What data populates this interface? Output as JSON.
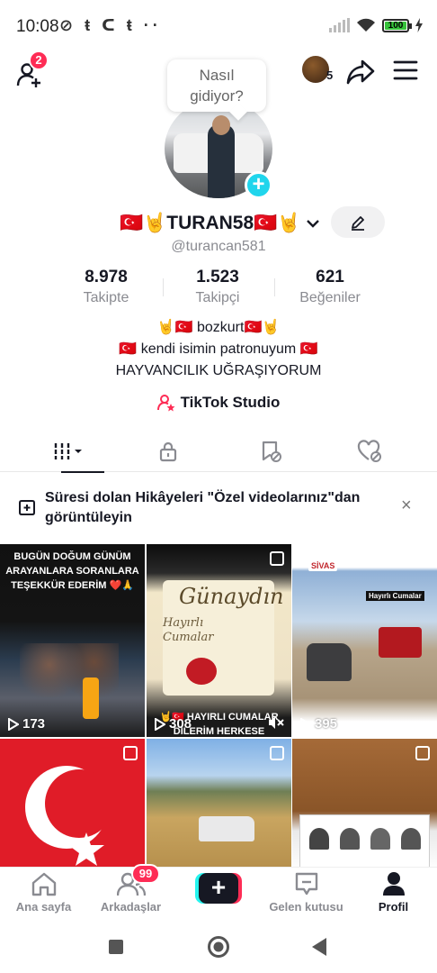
{
  "status_bar": {
    "time": "10:08",
    "notifications": "⊘ ŧ ᑕ ŧ ··",
    "battery": "100"
  },
  "top_bar": {
    "friend_requests_badge": "2",
    "story_count": "5"
  },
  "bubble": {
    "text_line1": "Nasıl",
    "text_line2": "gidiyor?"
  },
  "profile": {
    "display_name": "🇹🇷🤘TURAN58🇹🇷🤘",
    "handle": "@turancan581",
    "stats": [
      {
        "value": "8.978",
        "label": "Takipte"
      },
      {
        "value": "1.523",
        "label": "Takipçi"
      },
      {
        "value": "621",
        "label": "Beğeniler"
      }
    ],
    "bio": [
      "🤘🇹🇷 bozkurt🇹🇷🤘",
      "🇹🇷 kendi isimin patronuyum 🇹🇷",
      "HAYVANCILIK UĞRAŞIYORUM"
    ],
    "studio_label": "TikTok Studio"
  },
  "notice": {
    "text": "Süresi dolan Hikâyeleri \"Özel videolarınız\"dan görüntüleyin",
    "close": "×"
  },
  "videos": [
    {
      "views": "173",
      "overlay": "BUGÜN DOĞUM GÜNÜM ARAYANLARA SORANLARA TEŞEKKÜR EDERİM ❤️🙏"
    },
    {
      "views": "308",
      "overlay": "Günaydın",
      "overlay2": "Hayırlı Cumalar",
      "caption": "🤘🇹🇷 HAYIRLI CUMALAR DİLERİM HERKESE"
    },
    {
      "views": "395",
      "overlay": "SİVAS",
      "overlay2": "Hayırlı Cumalar"
    },
    {
      "views": ""
    },
    {
      "views": ""
    },
    {
      "views": ""
    }
  ],
  "bottom_nav": {
    "home": "Ana sayfa",
    "friends": "Arkadaşlar",
    "friends_badge": "99",
    "create": "+",
    "inbox": "Gelen kutusu",
    "profile": "Profil"
  },
  "colors": {
    "accent": "#fe2c55",
    "cyan": "#25f4ee",
    "text": "#161823",
    "muted": "#8a8b91"
  }
}
